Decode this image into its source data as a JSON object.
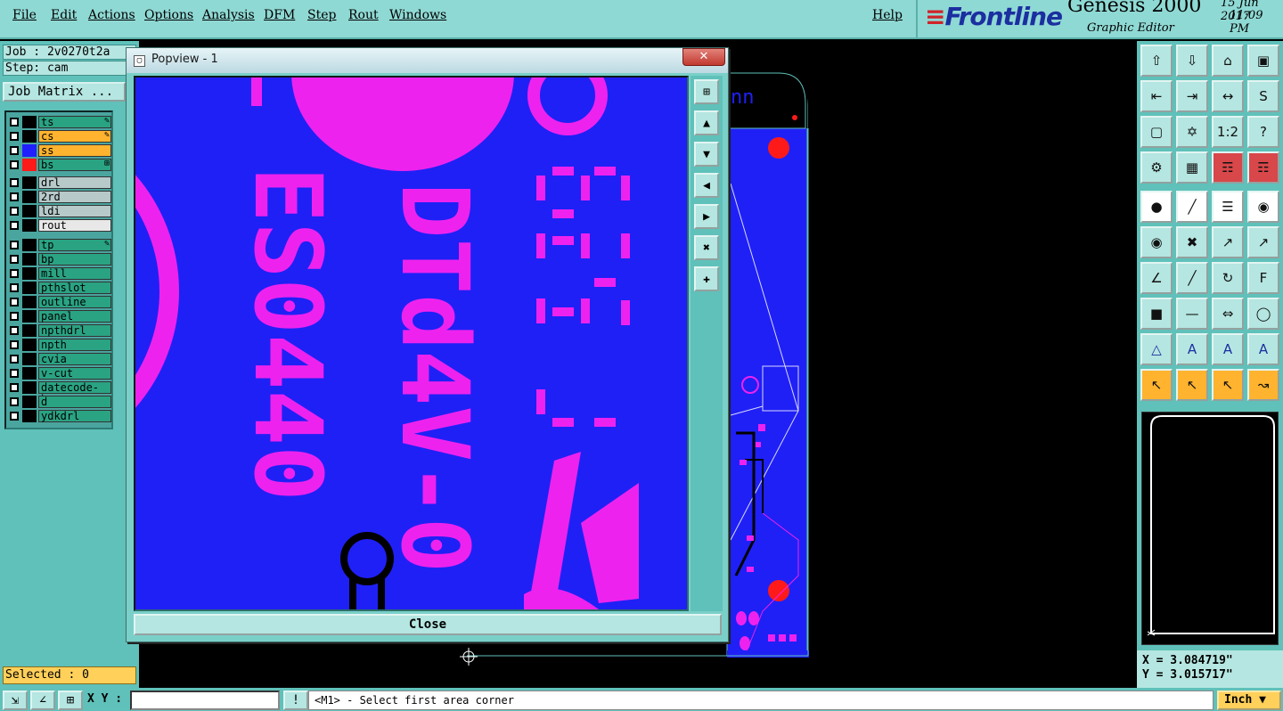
{
  "menu": {
    "items": [
      "File",
      "Edit",
      "Actions",
      "Options",
      "Analysis",
      "DFM",
      "Step",
      "Rout",
      "Windows"
    ],
    "help": "Help"
  },
  "brand": {
    "logo": "Frontline",
    "product": "Genesis 2000",
    "subtitle": "Graphic Editor",
    "date": "15 Jun 2017",
    "time": "11:09 PM"
  },
  "left": {
    "job": "Job : 2v0270t2a",
    "step": "Step: cam",
    "job_matrix": "Job Matrix ...",
    "layers": [
      {
        "name": "ts",
        "bg": "#2aa383",
        "swatch": "#000000",
        "mark": "✎"
      },
      {
        "name": "cs",
        "bg": "#ffb32e",
        "swatch": "#000000",
        "mark": "✎"
      },
      {
        "name": "ss",
        "bg": "#ffb32e",
        "swatch": "#2020ff",
        "mark": ""
      },
      {
        "name": "bs",
        "bg": "#2aa383",
        "swatch": "#ff1a1a",
        "mark": "⊞"
      },
      {
        "name": "drl",
        "bg": "#b7c9c9",
        "swatch": "#000000",
        "mark": ""
      },
      {
        "name": "2rd",
        "bg": "#b7c9c9",
        "swatch": "#000000",
        "mark": ""
      },
      {
        "name": "ldi",
        "bg": "#b7c9c9",
        "swatch": "#000000",
        "mark": ""
      },
      {
        "name": "rout",
        "bg": "#e8e8e8",
        "swatch": "#000000",
        "mark": ""
      },
      {
        "name": "tp",
        "bg": "#2aa383",
        "swatch": "#000000",
        "mark": "✎"
      },
      {
        "name": "bp",
        "bg": "#2aa383",
        "swatch": "#000000",
        "mark": ""
      },
      {
        "name": "mill",
        "bg": "#2aa383",
        "swatch": "#000000",
        "mark": ""
      },
      {
        "name": "pthslot",
        "bg": "#2aa383",
        "swatch": "#000000",
        "mark": ""
      },
      {
        "name": "outline",
        "bg": "#2aa383",
        "swatch": "#000000",
        "mark": ""
      },
      {
        "name": "panel",
        "bg": "#2aa383",
        "swatch": "#000000",
        "mark": ""
      },
      {
        "name": "npthdrl",
        "bg": "#2aa383",
        "swatch": "#000000",
        "mark": ""
      },
      {
        "name": "npth",
        "bg": "#2aa383",
        "swatch": "#000000",
        "mark": ""
      },
      {
        "name": "cvia",
        "bg": "#2aa383",
        "swatch": "#000000",
        "mark": ""
      },
      {
        "name": "v-cut",
        "bg": "#2aa383",
        "swatch": "#000000",
        "mark": ""
      },
      {
        "name": "datecode-bs",
        "bg": "#2aa383",
        "swatch": "#000000",
        "mark": ""
      },
      {
        "name": "d",
        "bg": "#2aa383",
        "swatch": "#000000",
        "mark": ""
      },
      {
        "name": "ydkdrl",
        "bg": "#2aa383",
        "swatch": "#000000",
        "mark": ""
      }
    ],
    "selected": "Selected : 0"
  },
  "popview": {
    "title": "Popview - 1",
    "close_x": "✕",
    "close_button": "Close"
  },
  "bottom": {
    "xy_label": "X Y :",
    "xy_value": "",
    "message": "<M1> - Select first area corner",
    "units": "Inch"
  },
  "coords": {
    "x": "X = 3.084719\"",
    "y": "Y = 3.015717\""
  },
  "colors": {
    "panel": "#5fc1ba",
    "menubar": "#8fd9d4",
    "board_blue": "#1f20f6",
    "copper_magenta": "#ee22ee"
  }
}
